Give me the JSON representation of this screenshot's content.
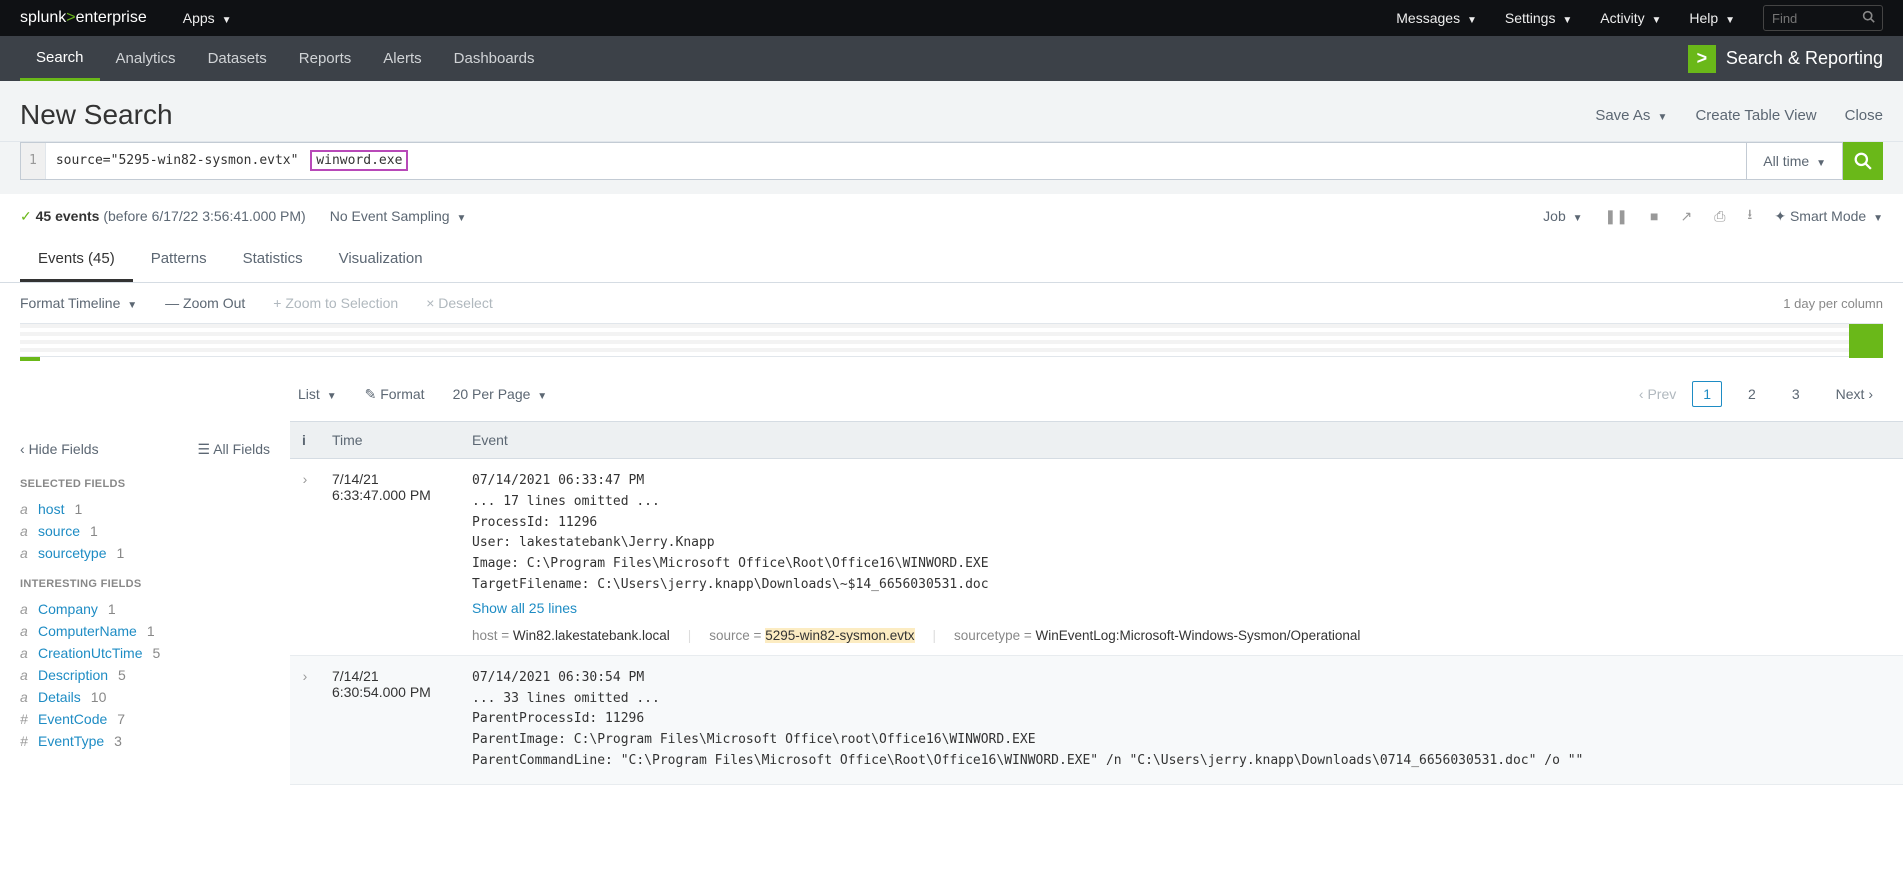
{
  "topbar": {
    "logo_white": "splunk",
    "logo_divider": ">",
    "logo_green": "enterprise",
    "apps": "Apps",
    "messages": "Messages",
    "settings": "Settings",
    "activity": "Activity",
    "help": "Help",
    "find_placeholder": "Find"
  },
  "nav": {
    "search": "Search",
    "analytics": "Analytics",
    "datasets": "Datasets",
    "reports": "Reports",
    "alerts": "Alerts",
    "dashboards": "Dashboards",
    "app_label": "Search & Reporting"
  },
  "header": {
    "title": "New Search",
    "save_as": "Save As",
    "create_table": "Create Table View",
    "close": "Close"
  },
  "search": {
    "line_num": "1",
    "query_part1": "source=\"5295-win82-sysmon.evtx\"",
    "query_part2": "winword.exe",
    "time_range": "All time"
  },
  "status": {
    "check": "✓",
    "count_label": "45 events",
    "subtext": "(before 6/17/22 3:56:41.000 PM)",
    "sampling": "No Event Sampling",
    "job": "Job",
    "smart_mode": "Smart Mode"
  },
  "result_tabs": {
    "events": "Events (45)",
    "patterns": "Patterns",
    "statistics": "Statistics",
    "visualization": "Visualization"
  },
  "timeline": {
    "format": "Format Timeline",
    "zoom_out": "— Zoom Out",
    "zoom_sel": "+ Zoom to Selection",
    "deselect": "× Deselect",
    "scale": "1 day per column"
  },
  "events_toolbar": {
    "list": "List",
    "format": "Format",
    "per_page": "20 Per Page",
    "prev": "Prev",
    "p1": "1",
    "p2": "2",
    "p3": "3",
    "next": "Next"
  },
  "fields": {
    "hide": "Hide Fields",
    "all": "All Fields",
    "selected_heading": "SELECTED FIELDS",
    "interesting_heading": "INTERESTING FIELDS",
    "selected": [
      {
        "t": "a",
        "name": "host",
        "cnt": "1"
      },
      {
        "t": "a",
        "name": "source",
        "cnt": "1"
      },
      {
        "t": "a",
        "name": "sourcetype",
        "cnt": "1"
      }
    ],
    "interesting": [
      {
        "t": "a",
        "name": "Company",
        "cnt": "1"
      },
      {
        "t": "a",
        "name": "ComputerName",
        "cnt": "1"
      },
      {
        "t": "a",
        "name": "CreationUtcTime",
        "cnt": "5"
      },
      {
        "t": "a",
        "name": "Description",
        "cnt": "5"
      },
      {
        "t": "a",
        "name": "Details",
        "cnt": "10"
      },
      {
        "t": "#",
        "name": "EventCode",
        "cnt": "7"
      },
      {
        "t": "#",
        "name": "EventType",
        "cnt": "3"
      }
    ]
  },
  "table": {
    "col_i": "i",
    "col_time": "Time",
    "col_event": "Event",
    "rows": [
      {
        "time_line1": "7/14/21",
        "time_line2": "6:33:47.000 PM",
        "raw": "07/14/2021 06:33:47 PM\n... 17 lines omitted ...\nProcessId: 11296\nUser: lakestatebank\\Jerry.Knapp\nImage: C:\\Program Files\\Microsoft Office\\Root\\Office16\\WINWORD.EXE\nTargetFilename: C:\\Users\\jerry.knapp\\Downloads\\~$14_6656030531.doc",
        "show_lines": "Show all 25 lines",
        "meta": {
          "host_k": "host =",
          "host_v": "Win82.lakestatebank.local",
          "source_k": "source =",
          "source_v": "5295-win82-sysmon.evtx",
          "stype_k": "sourcetype =",
          "stype_v": "WinEventLog:Microsoft-Windows-Sysmon/Operational"
        }
      },
      {
        "time_line1": "7/14/21",
        "time_line2": "6:30:54.000 PM",
        "raw": "07/14/2021 06:30:54 PM\n... 33 lines omitted ...\nParentProcessId: 11296\nParentImage: C:\\Program Files\\Microsoft Office\\root\\Office16\\WINWORD.EXE\nParentCommandLine: \"C:\\Program Files\\Microsoft Office\\Root\\Office16\\WINWORD.EXE\" /n \"C:\\Users\\jerry.knapp\\Downloads\\0714_6656030531.doc\" /o \"\""
      }
    ]
  }
}
